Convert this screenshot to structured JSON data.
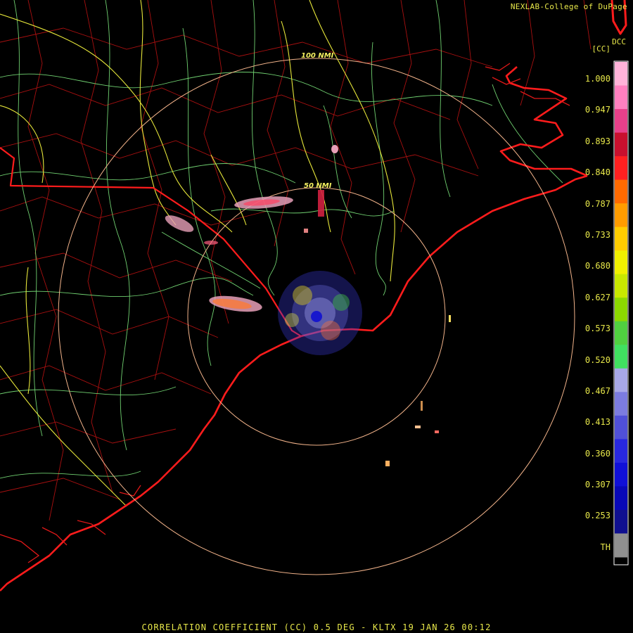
{
  "credit": "NEXLAB-College of DuPage",
  "product_id": "DCC",
  "product_unit": "[CC]",
  "footer": "CORRELATION COEFFICIENT (CC) 0.5 DEG - KLTX 19 JAN 26 00:12",
  "range_rings": [
    "50 NMI",
    "100 NMI"
  ],
  "legend": {
    "labels": [
      "1.000",
      "0.947",
      "0.893",
      "0.840",
      "0.787",
      "0.733",
      "0.680",
      "0.627",
      "0.573",
      "0.520",
      "0.467",
      "0.413",
      "0.360",
      "0.307",
      "0.253",
      "TH"
    ],
    "colors": [
      "#ffb3d9",
      "#ff80c0",
      "#e8408a",
      "#c8102e",
      "#ff2020",
      "#ff6a00",
      "#ff9c00",
      "#ffcc00",
      "#f0f000",
      "#c8e800",
      "#8cd800",
      "#50d040",
      "#40e060",
      "#a8a8e8",
      "#7c7ce0",
      "#5050d8",
      "#2828e0",
      "#1010d8",
      "#0808b8",
      "#101090",
      "#909090"
    ]
  },
  "colors": {
    "coast_state": "#ff1c1c",
    "county": "#b81212",
    "roads_major": "#e8e83c",
    "roads_minor": "#7ce07c",
    "range_ring": "#f2b38a",
    "text": "#e8e84a"
  }
}
